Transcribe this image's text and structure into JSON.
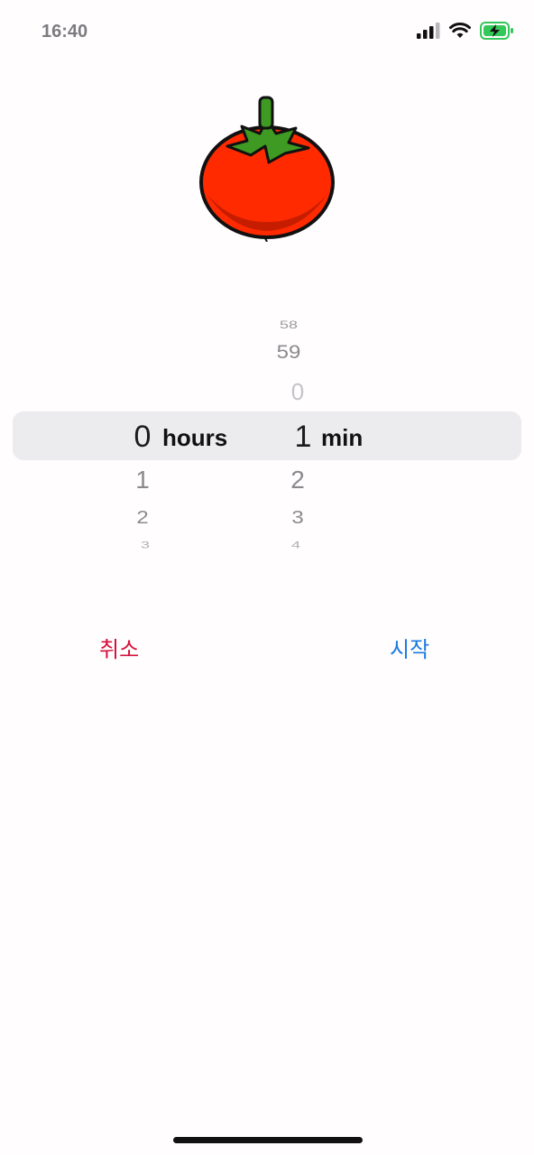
{
  "status_bar": {
    "time": "16:40",
    "icons": [
      "signal-icon",
      "wifi-icon",
      "battery-charging-icon"
    ],
    "battery_color": "#34c759"
  },
  "illustration": {
    "name": "tomato-icon"
  },
  "picker": {
    "hours": {
      "selected": "0",
      "unit": "hours",
      "below": [
        "1",
        "2",
        "3"
      ]
    },
    "minutes": {
      "selected": "1",
      "unit": "min",
      "above": [
        "58",
        "59",
        "0"
      ],
      "below": [
        "2",
        "3",
        "4"
      ]
    }
  },
  "actions": {
    "cancel_label": "취소",
    "start_label": "시작",
    "cancel_color": "#d4113c",
    "start_color": "#1b7be0"
  }
}
